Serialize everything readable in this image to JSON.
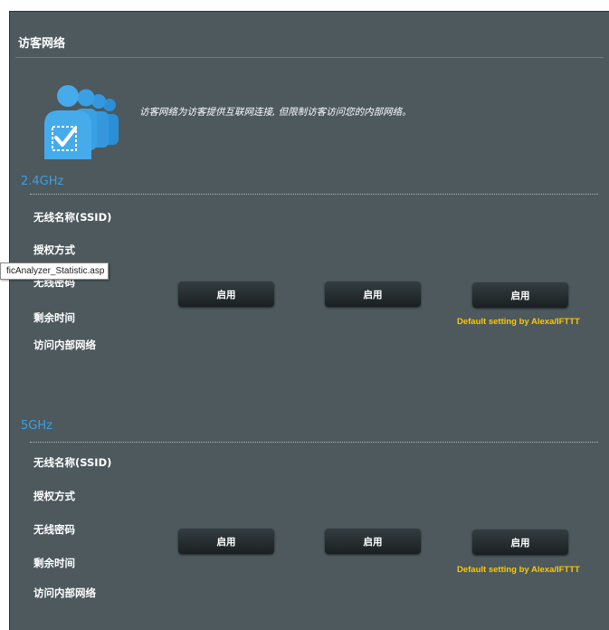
{
  "header": {
    "title": "访客网络"
  },
  "intro": {
    "description": "访客网络为访客提供互联网连接, 但限制访客访问您的内部网络。"
  },
  "icons": {
    "guest_network": "guest-network-people-check-icon"
  },
  "colors": {
    "panel": "#4d595d",
    "band_title": "#3da0e0",
    "note": "#fcc800"
  },
  "tooltip": {
    "text": "ficAnalyzer_Statistic.asp"
  },
  "band_24": {
    "title": "2.4GHz",
    "labels": [
      "无线名称(SSID)",
      "授权方式",
      "无线密码",
      "剩余时间",
      "访问内部网络"
    ],
    "buttons": [
      "启用",
      "启用",
      "启用"
    ],
    "note": "Default setting by Alexa/IFTTT"
  },
  "band_5": {
    "title": "5GHz",
    "labels": [
      "无线名称(SSID)",
      "授权方式",
      "无线密码",
      "剩余时间",
      "访问内部网络"
    ],
    "buttons": [
      "启用",
      "启用",
      "启用"
    ],
    "note": "Default setting by Alexa/IFTTT"
  }
}
